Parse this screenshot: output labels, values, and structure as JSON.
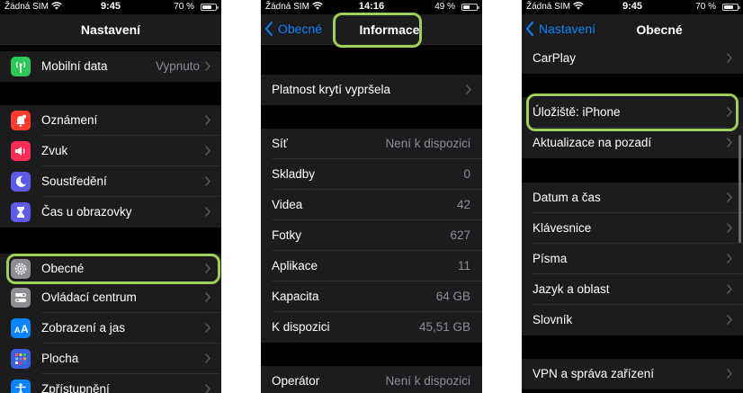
{
  "screens": [
    {
      "status": {
        "carrier": "Žádná SIM",
        "time": "9:45",
        "battery": "70 %"
      },
      "title": "Nastavení",
      "rows": [
        {
          "label": "Mobilní data",
          "value": "Vypnuto",
          "icon": "antenna-icon",
          "color": "#30c759"
        },
        {
          "label": "Oznámení",
          "icon": "notification-bell-icon",
          "color": "#ff3b30"
        },
        {
          "label": "Zvuk",
          "icon": "speaker-icon",
          "color": "#ff2d55"
        },
        {
          "label": "Soustředění",
          "icon": "moon-icon",
          "color": "#5e5ce6"
        },
        {
          "label": "Čas u obrazovky",
          "icon": "hourglass-icon",
          "color": "#5e5ce6"
        },
        {
          "label": "Obecné",
          "icon": "gear-icon",
          "color": "#8e8e93"
        },
        {
          "label": "Ovládací centrum",
          "icon": "toggles-icon",
          "color": "#8e8e93"
        },
        {
          "label": "Zobrazení a jas",
          "icon": "text-size-icon",
          "color": "#0a84ff"
        },
        {
          "label": "Plocha",
          "icon": "app-grid-icon",
          "color": "#3a5fe0"
        },
        {
          "label": "Zpřístupnění",
          "icon": "accessibility-icon",
          "color": "#0a84ff"
        }
      ]
    },
    {
      "status": {
        "carrier": "Žádná SIM",
        "time": "14:16",
        "battery": "49 %"
      },
      "back": "Obecné",
      "title": "Informace",
      "rows": [
        {
          "label": "Platnost krytí vypršela",
          "value": ""
        },
        {
          "label": "Síť",
          "value": "Není k dispozici"
        },
        {
          "label": "Skladby",
          "value": "0"
        },
        {
          "label": "Videa",
          "value": "42"
        },
        {
          "label": "Fotky",
          "value": "627"
        },
        {
          "label": "Aplikace",
          "value": "11"
        },
        {
          "label": "Kapacita",
          "value": "64 GB"
        },
        {
          "label": "K dispozici",
          "value": "45,51 GB"
        },
        {
          "label": "Operátor",
          "value": "Není k dispozici"
        }
      ]
    },
    {
      "status": {
        "carrier": "Žádná SIM",
        "time": "9:45",
        "battery": "70 %"
      },
      "back": "Nastavení",
      "title": "Obecné",
      "rows": [
        {
          "label": "CarPlay"
        },
        {
          "label": "Úložiště: iPhone"
        },
        {
          "label": "Aktualizace na pozadí"
        },
        {
          "label": "Datum a čas"
        },
        {
          "label": "Klávesnice"
        },
        {
          "label": "Písma"
        },
        {
          "label": "Jazyk a oblast"
        },
        {
          "label": "Slovník"
        },
        {
          "label": "VPN a správa zařízení"
        }
      ]
    }
  ]
}
